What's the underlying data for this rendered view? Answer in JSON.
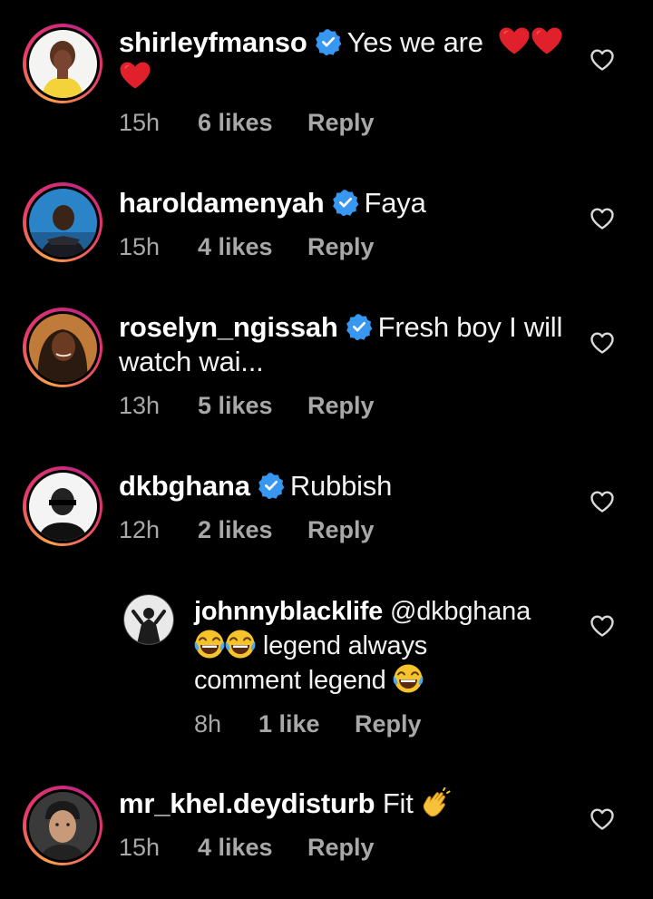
{
  "colors": {
    "background": "#000000",
    "text": "#f2f2f2",
    "meta": "#a8a8a8",
    "verified": "#3897f0",
    "heart_emoji": "#e0202a"
  },
  "comments": [
    {
      "username": "shirleyfmanso",
      "verified": true,
      "text_line1": "Yes we are",
      "time": "15h",
      "likes": "6 likes",
      "reply": "Reply",
      "emoji": "red-heart x3"
    },
    {
      "username": "haroldamenyah",
      "verified": true,
      "text": "Faya",
      "time": "15h",
      "likes": "4 likes",
      "reply": "Reply"
    },
    {
      "username": "roselyn_ngissah",
      "verified": true,
      "text_line1": "Fresh boy I will",
      "text_line2": "watch wai...",
      "time": "13h",
      "likes": "5 likes",
      "reply": "Reply"
    },
    {
      "username": "dkbghana",
      "verified": true,
      "text": "Rubbish",
      "time": "12h",
      "likes": "2 likes",
      "reply": "Reply"
    },
    {
      "username": "johnnyblacklife",
      "verified": false,
      "mention": "@dkbghana",
      "text_line2": "legend always",
      "text_line3": "comment legend",
      "time": "8h",
      "likes": "1 like",
      "reply": "Reply",
      "emoji": "face-with-tears-of-joy x3"
    },
    {
      "username": "mr_khel.deydisturb",
      "verified": false,
      "text": "Fit",
      "time": "15h",
      "likes": "4 likes",
      "reply": "Reply",
      "emoji": "clapping-hands"
    }
  ]
}
